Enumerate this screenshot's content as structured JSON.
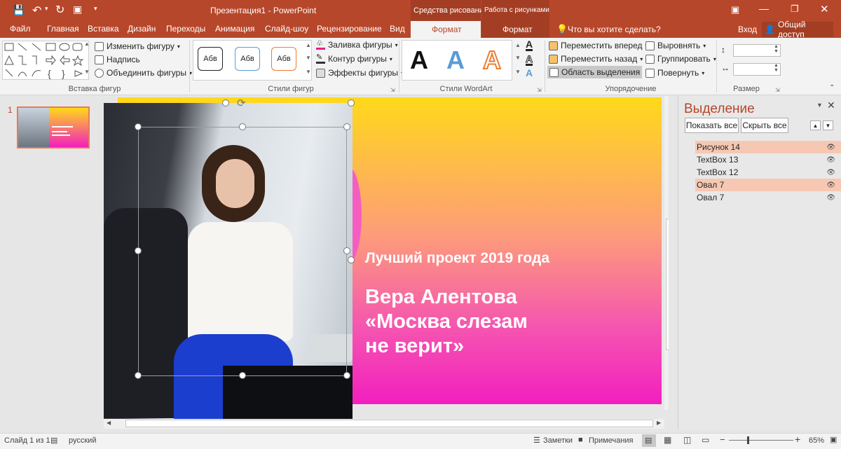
{
  "window": {
    "title": "Презентация1 - PowerPoint"
  },
  "context_groups": {
    "drawing": "Средства рисования",
    "picture": "Работа с рисунками"
  },
  "tabs": [
    "Файл",
    "Главная",
    "Вставка",
    "Дизайн",
    "Переходы",
    "Анимация",
    "Слайд-шоу",
    "Рецензирование",
    "Вид"
  ],
  "context_tabs": {
    "drawing_format": "Формат",
    "picture_format": "Формат"
  },
  "tell_me": "Что вы хотите сделать?",
  "signin": "Вход",
  "share": "Общий доступ",
  "ribbon": {
    "insert_shapes": {
      "label": "Вставка фигур",
      "edit_shape": "Изменить фигуру",
      "textbox": "Надпись",
      "merge_shapes": "Объединить фигуры"
    },
    "shape_styles": {
      "label": "Стили фигур",
      "style_text": "Абв",
      "fill": "Заливка фигуры",
      "outline": "Контур фигуры",
      "effects": "Эффекты фигуры"
    },
    "wordart": {
      "label": "Стили WordArt",
      "letter": "A"
    },
    "arrange": {
      "label": "Упорядочение",
      "bring_forward": "Переместить вперед",
      "send_backward": "Переместить назад",
      "selection_pane": "Область выделения",
      "align": "Выровнять",
      "group": "Группировать",
      "rotate": "Повернуть"
    },
    "size": {
      "label": "Размер"
    }
  },
  "slide": {
    "number": "1",
    "subtitle": "Лучший проект 2019 года",
    "title_lines": [
      "Вера Алентова",
      "«Москва слезам",
      "не верит»"
    ]
  },
  "selection_pane": {
    "title": "Выделение",
    "show_all": "Показать все",
    "hide_all": "Скрыть все",
    "items": [
      {
        "name": "Рисунок 14",
        "selected": true
      },
      {
        "name": "TextBox 13",
        "selected": false
      },
      {
        "name": "TextBox 12",
        "selected": false
      },
      {
        "name": "Овал 7",
        "selected": true
      },
      {
        "name": "Овал 7",
        "selected": false
      }
    ]
  },
  "status": {
    "slide_info": "Слайд 1 из 1",
    "language": "русский",
    "notes": "Заметки",
    "comments": "Примечания",
    "zoom": "65%"
  },
  "colors": {
    "accent": "#b7472a",
    "gradient_top": "#ffd91a",
    "gradient_bottom": "#f21fbf",
    "selection_highlight": "#f6c8b3"
  }
}
